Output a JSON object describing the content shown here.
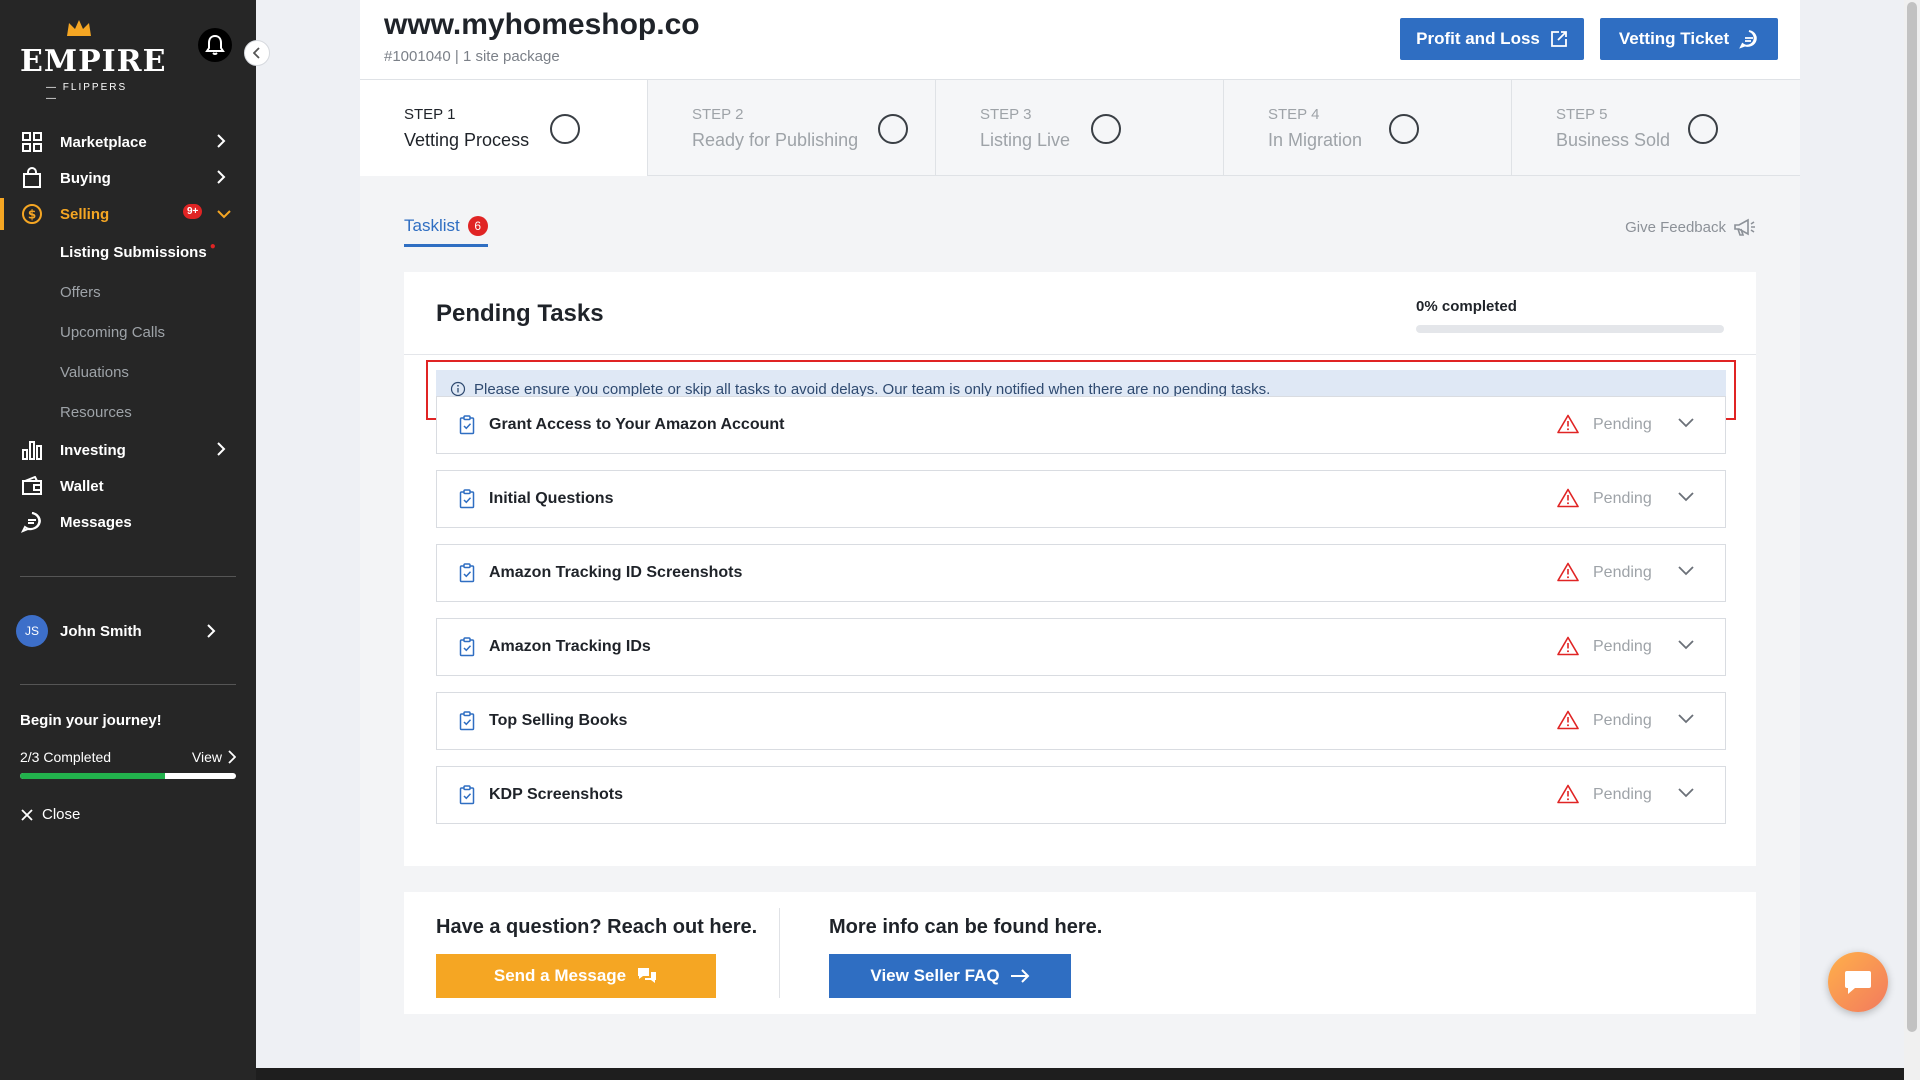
{
  "sidebar": {
    "logo": {
      "word": "EMPIRE",
      "sub": "— FLIPPERS —"
    },
    "nav": [
      {
        "label": "Marketplace",
        "icon": "grid-icon"
      },
      {
        "label": "Buying",
        "icon": "bag-icon"
      },
      {
        "label": "Selling",
        "icon": "dollar-circle-icon",
        "badge": "9+"
      },
      {
        "label": "Investing",
        "icon": "bar-chart-icon"
      },
      {
        "label": "Wallet",
        "icon": "wallet-icon"
      },
      {
        "label": "Messages",
        "icon": "chat-icon"
      }
    ],
    "selling_sub": [
      "Listing Submissions",
      "Offers",
      "Upcoming Calls",
      "Valuations",
      "Resources"
    ],
    "user": {
      "initials": "JS",
      "name": "John Smith"
    },
    "journey": {
      "title": "Begin your journey!",
      "progress_text": "2/3 Completed",
      "view_label": "View",
      "progress": 0.67
    },
    "close_label": "Close"
  },
  "header": {
    "site": "www.myhomeshop.co",
    "subtitle": "#1001040 | 1 site package",
    "profit_loss_label": "Profit and Loss",
    "vetting_ticket_label": "Vetting Ticket"
  },
  "steps": [
    {
      "num": "STEP 1",
      "label": "Vetting Process"
    },
    {
      "num": "STEP 2",
      "label": "Ready for Publishing"
    },
    {
      "num": "STEP 3",
      "label": "Listing Live"
    },
    {
      "num": "STEP 4",
      "label": "In Migration"
    },
    {
      "num": "STEP 5",
      "label": "Business Sold"
    }
  ],
  "tasklist": {
    "tab_label": "Tasklist",
    "count": "6",
    "feedback_label": "Give Feedback"
  },
  "pending": {
    "title": "Pending Tasks",
    "progress_text": "0% completed",
    "progress": 0,
    "notice": "Please ensure you complete or skip all tasks to avoid delays. Our team is only notified when there are no pending tasks.",
    "status_label": "Pending",
    "tasks": [
      "Grant Access to Your Amazon Account",
      "Initial Questions",
      "Amazon Tracking ID Screenshots",
      "Amazon Tracking IDs",
      "Top Selling Books",
      "KDP Screenshots"
    ]
  },
  "help": {
    "question_title": "Have a question? Reach out here.",
    "info_title": "More info can be found here.",
    "send_label": "Send a Message",
    "faq_label": "View Seller FAQ"
  },
  "colors": {
    "accent": "#f5a623",
    "primary": "#2f6ec2",
    "danger": "#e02424",
    "sidebar": "#262626"
  }
}
